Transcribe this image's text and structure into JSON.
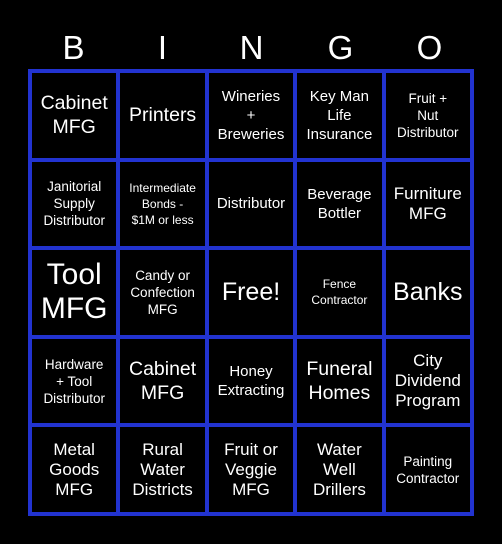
{
  "header": {
    "letters": [
      "B",
      "I",
      "N",
      "G",
      "O"
    ]
  },
  "colors": {
    "background": "#000000",
    "grid_border": "#2233d0",
    "text": "#ffffff"
  },
  "board": {
    "rows": [
      [
        "Cabinet\nMFG",
        "Printers",
        "Wineries\n+\nBreweries",
        "Key Man\nLife\nInsurance",
        "Fruit +\nNut\nDistributor"
      ],
      [
        "Janitorial\nSupply\nDistributor",
        "Intermediate\nBonds -\n$1M or less",
        "Distributor",
        "Beverage\nBottler",
        "Furniture\nMFG"
      ],
      [
        "Tool\nMFG",
        "Candy or\nConfection\nMFG",
        "Free!",
        "Fence\nContractor",
        "Banks"
      ],
      [
        "Hardware\n+ Tool\nDistributor",
        "Cabinet\nMFG",
        "Honey\nExtracting",
        "Funeral\nHomes",
        "City\nDividend\nProgram"
      ],
      [
        "Metal\nGoods\nMFG",
        "Rural\nWater\nDistricts",
        "Fruit or\nVeggie\nMFG",
        "Water\nWell\nDrillers",
        "Painting\nContractor"
      ]
    ]
  }
}
